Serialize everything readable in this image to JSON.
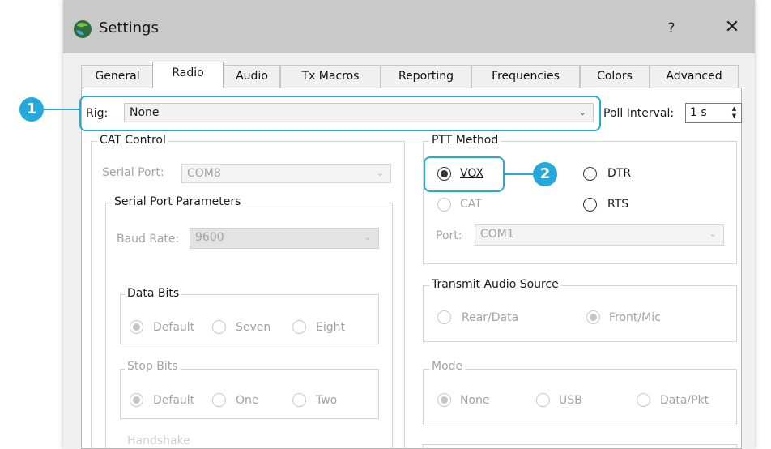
{
  "window": {
    "title": "Settings",
    "help_glyph": "?",
    "close_glyph": "✕"
  },
  "tabs": [
    {
      "label": "General",
      "mnemonic": "l"
    },
    {
      "label": "Radio",
      "mnemonic": "R"
    },
    {
      "label": "Audio",
      "mnemonic": "u"
    },
    {
      "label": "Tx Macros",
      "mnemonic": "M"
    },
    {
      "label": "Reporting",
      "mnemonic": "g"
    },
    {
      "label": "Frequencies",
      "mnemonic": ""
    },
    {
      "label": "Colors",
      "mnemonic": ""
    },
    {
      "label": "Advanced",
      "mnemonic": ""
    }
  ],
  "rig": {
    "label": "Rig:",
    "value": "None",
    "poll_label": "Poll Interval:",
    "poll_value": "1 s"
  },
  "cat": {
    "title": "CAT Control",
    "serial_port_label": "Serial Port:",
    "serial_port_value": "COM8",
    "params_title": "Serial Port Parameters",
    "baud_label": "Baud Rate:",
    "baud_value": "9600",
    "data_bits_title": "Data Bits",
    "data_bits_options": [
      "Default",
      "Seven",
      "Eight"
    ],
    "stop_bits_title": "Stop Bits",
    "stop_bits_options": [
      "Default",
      "One",
      "Two"
    ],
    "handshake_title": "Handshake"
  },
  "ptt": {
    "title": "PTT Method",
    "vox": "VOX",
    "dtr": "DTR",
    "cat": "CAT",
    "rts": "RTS",
    "port_label": "Port:",
    "port_value": "COM1"
  },
  "audio_source": {
    "title": "Transmit Audio Source",
    "rear": "Rear/Data",
    "front": "Front/Mic"
  },
  "mode": {
    "title": "Mode",
    "none": "None",
    "usb": "USB",
    "data": "Data/Pkt"
  },
  "callouts": {
    "one": "1",
    "two": "2"
  },
  "icons": {
    "chevron": "chevron-down-icon",
    "app": "app-globe-icon"
  },
  "colors": {
    "accent": "#25a9dc"
  }
}
